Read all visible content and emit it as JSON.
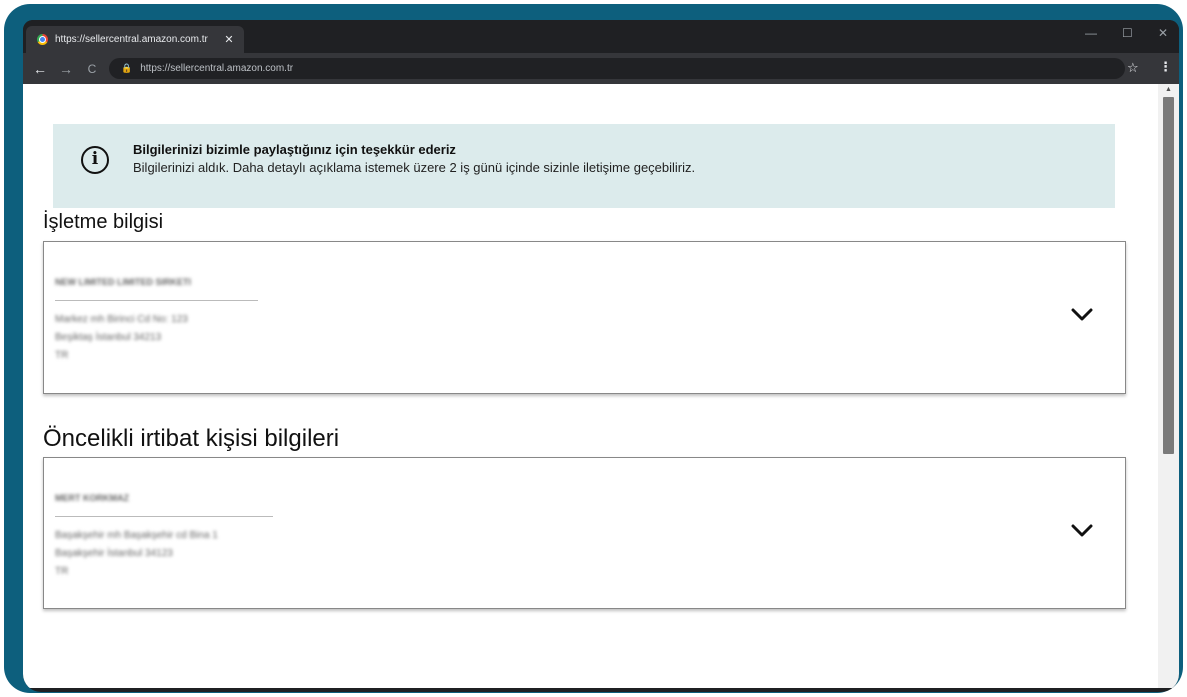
{
  "browser": {
    "tab_title": "https://sellercentral.amazon.com.tr",
    "tab_close": "✕",
    "url": "https://sellercentral.amazon.com.tr",
    "window_controls": {
      "minimize": "—",
      "maximize": "☐",
      "close": "✕"
    },
    "nav": {
      "back": "←",
      "forward": "→",
      "reload": "C"
    },
    "star": "☆",
    "menu": "⋮"
  },
  "alert": {
    "title": "Bilgilerinizi bizimle paylaştığınız için teşekkür ederiz",
    "body": "Bilgilerinizi aldık. Daha detaylı açıklama istemek üzere 2 iş günü içinde sizinle iletişime geçebiliriz.",
    "icon": "info-icon"
  },
  "business": {
    "heading": "İşletme bilgisi",
    "name": "NEW LIMITED LIMITED SIRKETI",
    "address_line1": "Markez mh Birinci Cd No: 123",
    "address_line2": "Beşiktaş İstanbul 34213",
    "country": "TR"
  },
  "contact": {
    "heading": "Öncelikli irtibat kişisi bilgileri",
    "name": "MERT KORKMAZ",
    "address_line1": "Başakşehir mh Başakşehir cd Bina 1",
    "address_line2": "Başakşehir İstanbul 34123",
    "country": "TR"
  }
}
